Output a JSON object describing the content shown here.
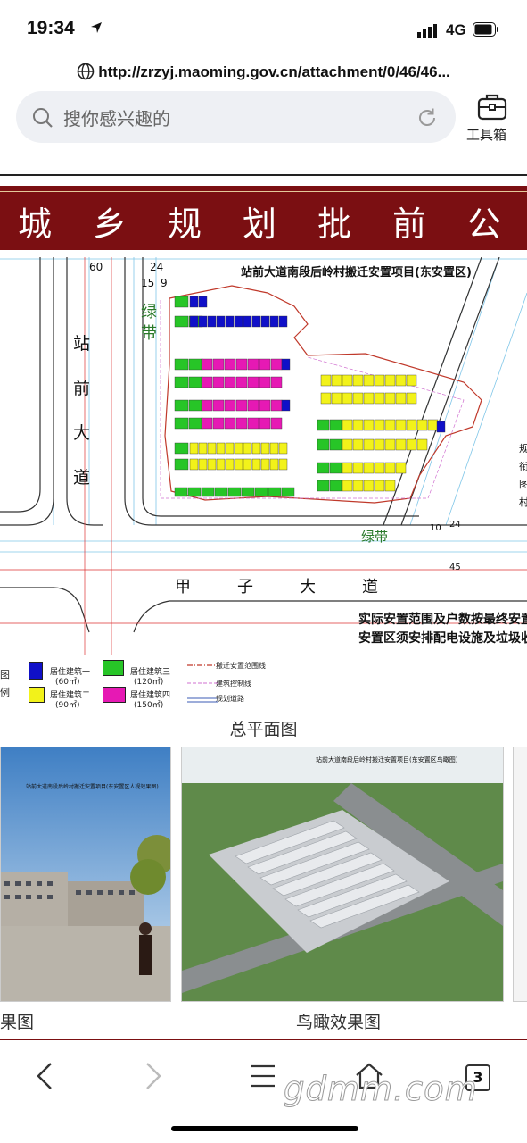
{
  "status": {
    "time": "19:34",
    "network": "4G"
  },
  "browser": {
    "url": "http://zrzyj.maoming.gov.cn/attachment/0/46/46...",
    "search_placeholder": "搜你感兴趣的",
    "toolbox_label": "工具箱"
  },
  "page": {
    "banner_title": "城乡规划批前公",
    "plan": {
      "project_title": "站前大道南段后岭村搬迁安置项目(东安置区)",
      "road_west": "站前大道",
      "road_south": "甲子大道",
      "green_belt_west": "绿带",
      "green_belt_south": "绿带",
      "dims": [
        "60",
        "24",
        "15",
        "9",
        "10",
        "24",
        "45"
      ],
      "notes": [
        "实际安置范围及户数按最终安置",
        "安置区须安排配电设施及垃圾收"
      ],
      "side_text": [
        "规",
        "衔",
        "图",
        "村"
      ]
    },
    "legend": {
      "left_label": [
        "图",
        "例"
      ],
      "items": [
        {
          "name": "居住建筑一",
          "area": "(60㎡)",
          "color": "#1010c8"
        },
        {
          "name": "居住建筑二",
          "area": "(90㎡)",
          "color": "#f2f21a"
        },
        {
          "name": "居住建筑三",
          "area": "(120㎡)",
          "color": "#27c527"
        },
        {
          "name": "居住建筑四",
          "area": "(150㎡)",
          "color": "#e619b4"
        }
      ],
      "lines": [
        "搬迁安置范围线",
        "建筑控制线",
        "规划道路"
      ]
    },
    "plan_caption": "总平面图",
    "image_left_caption": "果图",
    "image_right_caption": "鸟瞰效果图",
    "image_left_inner_title": "站前大道南段后岭村搬迁安置项目(东安置区人视效果图)",
    "image_right_inner_title": "站前大道南段后岭村搬迁安置项目(东安置区鸟瞰图)"
  },
  "nav": {
    "tabs_count": "3"
  },
  "watermark": "gdmm.com"
}
